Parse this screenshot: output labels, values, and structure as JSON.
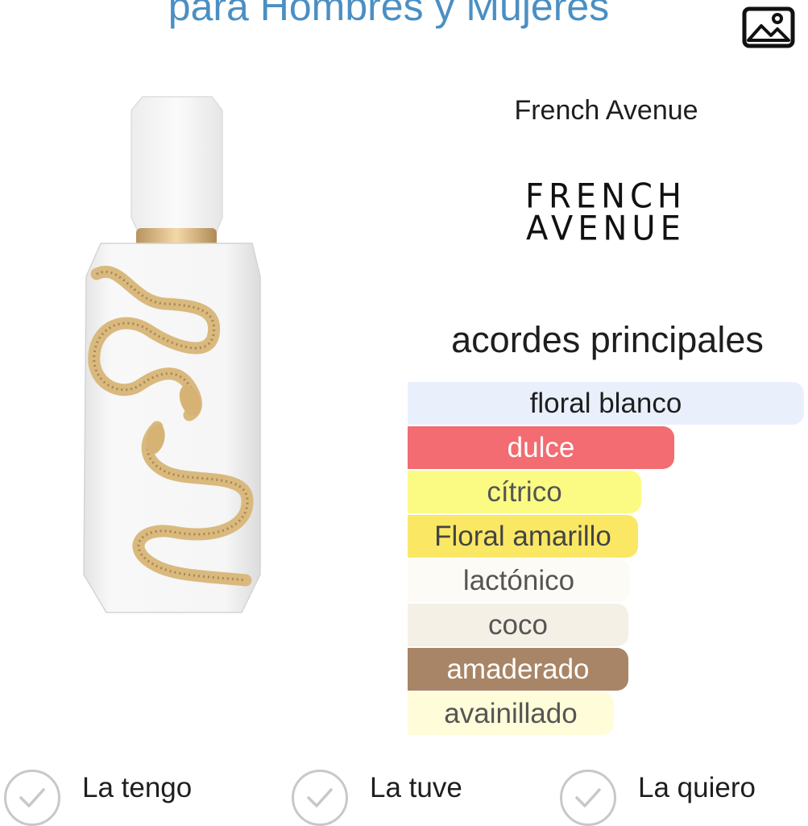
{
  "header": {
    "title": "para Hombres y Mujeres",
    "image_icon": "image-icon"
  },
  "brand": {
    "name": "French Avenue",
    "logo_line1": "FRENCH",
    "logo_line2": "AVENUE"
  },
  "accords": {
    "title": "acordes principales",
    "items": [
      {
        "label": "floral blanco",
        "level": 1.0,
        "color": "#e9f0fb",
        "text_color": "#1e1e1e"
      },
      {
        "label": "dulce",
        "level": 0.673,
        "color": "#f26c71",
        "text_color": "#ffffff"
      },
      {
        "label": "cítrico",
        "level": 0.589,
        "color": "#fbfb84",
        "text_color": "#555555"
      },
      {
        "label": "Floral amarillo",
        "level": 0.581,
        "color": "#fae865",
        "text_color": "#444444"
      },
      {
        "label": "lactónico",
        "level": 0.56,
        "color": "#fdfbf6",
        "text_color": "#555555"
      },
      {
        "label": "coco",
        "level": 0.556,
        "color": "#f5f0e6",
        "text_color": "#555555"
      },
      {
        "label": "amaderado",
        "level": 0.556,
        "color": "#a88566",
        "text_color": "#ffffff"
      },
      {
        "label": "avainillado",
        "level": 0.52,
        "color": "#fffcd9",
        "text_color": "#555555"
      }
    ]
  },
  "actions": [
    {
      "label": "La tengo",
      "icon": "check-icon"
    },
    {
      "label": "La tuve",
      "icon": "check-icon"
    },
    {
      "label": "La quiero",
      "icon": "check-icon"
    }
  ]
}
